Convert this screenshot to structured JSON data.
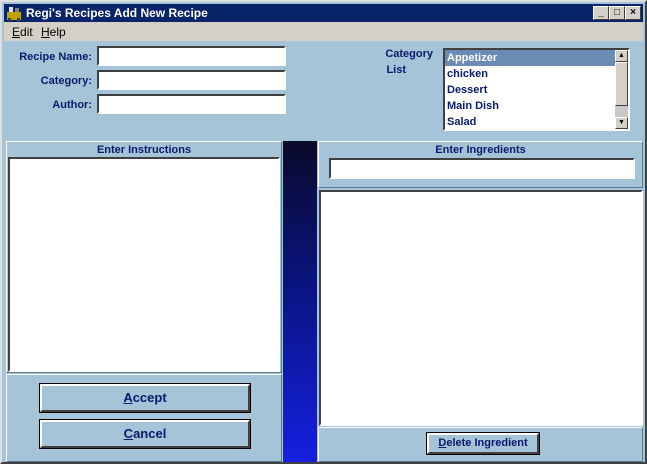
{
  "window": {
    "title": "Regi's Recipes   Add New Recipe",
    "controls": {
      "minimize": "_",
      "maximize": "□",
      "close": "×"
    }
  },
  "menu": [
    {
      "label": "Edit",
      "hotkey": "E",
      "rest": "dit"
    },
    {
      "label": "Help",
      "hotkey": "H",
      "rest": "elp"
    }
  ],
  "form": {
    "recipe_name_label": "Recipe Name:",
    "recipe_name_value": "",
    "category_label": "Category:",
    "category_value": "",
    "author_label": "Author:",
    "author_value": ""
  },
  "category_list": {
    "label_line1": "Category",
    "label_line2": "List",
    "items": [
      "Appetizer",
      "chicken",
      "Dessert",
      "Main Dish",
      "Salad"
    ],
    "selected": "Appetizer"
  },
  "instructions": {
    "header": "Enter Instructions",
    "value": ""
  },
  "ingredients": {
    "header": "Enter Ingredients",
    "input_value": "",
    "items": []
  },
  "buttons": {
    "accept": {
      "hotkey": "A",
      "rest": "ccept"
    },
    "cancel": {
      "hotkey": "C",
      "rest": "ancel"
    },
    "delete_ingredient": {
      "hotkey": "D",
      "rest": "elete Ingredient"
    }
  },
  "colors": {
    "accent": "#0a246a",
    "panel": "#a6c4d8",
    "text": "#0a1a6a",
    "selection": "#6a8cb4"
  }
}
